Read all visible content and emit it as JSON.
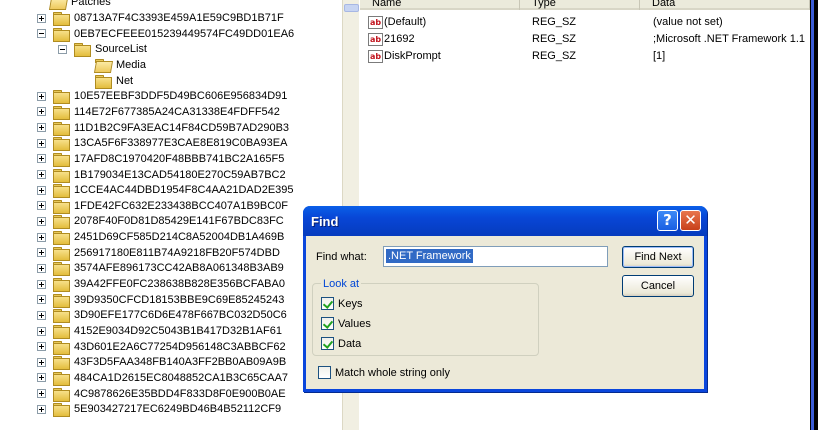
{
  "tree": {
    "root_label": "Patches",
    "items": [
      {
        "label": "08713A7F4C3393E459A1E59C9BD1B71F",
        "level": 0,
        "expander": "plus"
      },
      {
        "label": "0EB7ECFEEE015239449574FC49DD01EA6",
        "level": 0,
        "expander": "minus"
      },
      {
        "label": "SourceList",
        "level": 1,
        "expander": "minus"
      },
      {
        "label": "Media",
        "level": 2,
        "expander": "none",
        "open": true
      },
      {
        "label": "Net",
        "level": 2,
        "expander": "none"
      },
      {
        "label": "10E57EEBF3DDF5D49BC606E956834D91",
        "level": 0,
        "expander": "plus"
      },
      {
        "label": "114E72F677385A24CA31338E4FDFF542",
        "level": 0,
        "expander": "plus"
      },
      {
        "label": "11D1B2C9FA3EAC14F84CD59B7AD290B3",
        "level": 0,
        "expander": "plus"
      },
      {
        "label": "13CA5F6F338977E3CAE8E819C0BA93EA",
        "level": 0,
        "expander": "plus"
      },
      {
        "label": "17AFD8C1970420F48BBB741BC2A165F5",
        "level": 0,
        "expander": "plus"
      },
      {
        "label": "1B179034E13CAD54180E270C59AB7BC2",
        "level": 0,
        "expander": "plus"
      },
      {
        "label": "1CCE4AC44DBD1954F8C4AA21DAD2E395",
        "level": 0,
        "expander": "plus"
      },
      {
        "label": "1FDE42FC632E233438BCC407A1B9BC0F",
        "level": 0,
        "expander": "plus"
      },
      {
        "label": "2078F40F0D81D85429E141F67BDC83FC",
        "level": 0,
        "expander": "plus"
      },
      {
        "label": "2451D69CF585D214C8A52004DB1A469B",
        "level": 0,
        "expander": "plus"
      },
      {
        "label": "256917180E811B74A9218FB20F574DBD",
        "level": 0,
        "expander": "plus"
      },
      {
        "label": "3574AFE896173CC42AB8A061348B3AB9",
        "level": 0,
        "expander": "plus"
      },
      {
        "label": "39A42FFE0FC238638B828E356BCFABA0",
        "level": 0,
        "expander": "plus"
      },
      {
        "label": "39D9350CFCD18153BBE9C69E85245243",
        "level": 0,
        "expander": "plus"
      },
      {
        "label": "3D90EFE177C6D6E478F667BC032D50C6",
        "level": 0,
        "expander": "plus"
      },
      {
        "label": "4152E9034D92C5043B1B417D32B1AF61",
        "level": 0,
        "expander": "plus"
      },
      {
        "label": "43D601E2A6C77254D956148C3ABBCF62",
        "level": 0,
        "expander": "plus"
      },
      {
        "label": "43F3D5FAA348FB140A3FF2BB0AB09A9B",
        "level": 0,
        "expander": "plus"
      },
      {
        "label": "484CA1D2615EC8048852CA1B3C65CAA7",
        "level": 0,
        "expander": "plus"
      },
      {
        "label": "4C9878626E35BDD4F833D8F0E900B0AE",
        "level": 0,
        "expander": "plus"
      },
      {
        "label": "5E903427217EC6249BD46B4B52112CF9",
        "level": 0,
        "expander": "plus"
      }
    ]
  },
  "list": {
    "columns": [
      "Name",
      "Type",
      "Data"
    ],
    "rows": [
      {
        "name": "(Default)",
        "type": "REG_SZ",
        "data": "(value not set)",
        "icon": "string-value-icon"
      },
      {
        "name": "21692",
        "type": "REG_SZ",
        "data": ";Microsoft .NET Framework 1.1",
        "icon": "string-value-icon"
      },
      {
        "name": "DiskPrompt",
        "type": "REG_SZ",
        "data": "[1]",
        "icon": "string-value-icon"
      }
    ],
    "icon_text": "ab"
  },
  "find_dialog": {
    "title": "Find",
    "help_glyph": "?",
    "close_glyph": "✕",
    "find_what_label": "Find what:",
    "find_what_value": ".NET Framework",
    "find_next_label": "Find Next",
    "cancel_label": "Cancel",
    "look_at_label": "Look at",
    "options": [
      {
        "label": "Keys",
        "checked": true
      },
      {
        "label": "Values",
        "checked": true
      },
      {
        "label": "Data",
        "checked": true
      }
    ],
    "match_whole_label": "Match whole string only",
    "match_whole_checked": false
  },
  "colors": {
    "title_bar": "#0846d6",
    "selection": "#316ac5",
    "frame_accent": "#3b5cd6"
  }
}
